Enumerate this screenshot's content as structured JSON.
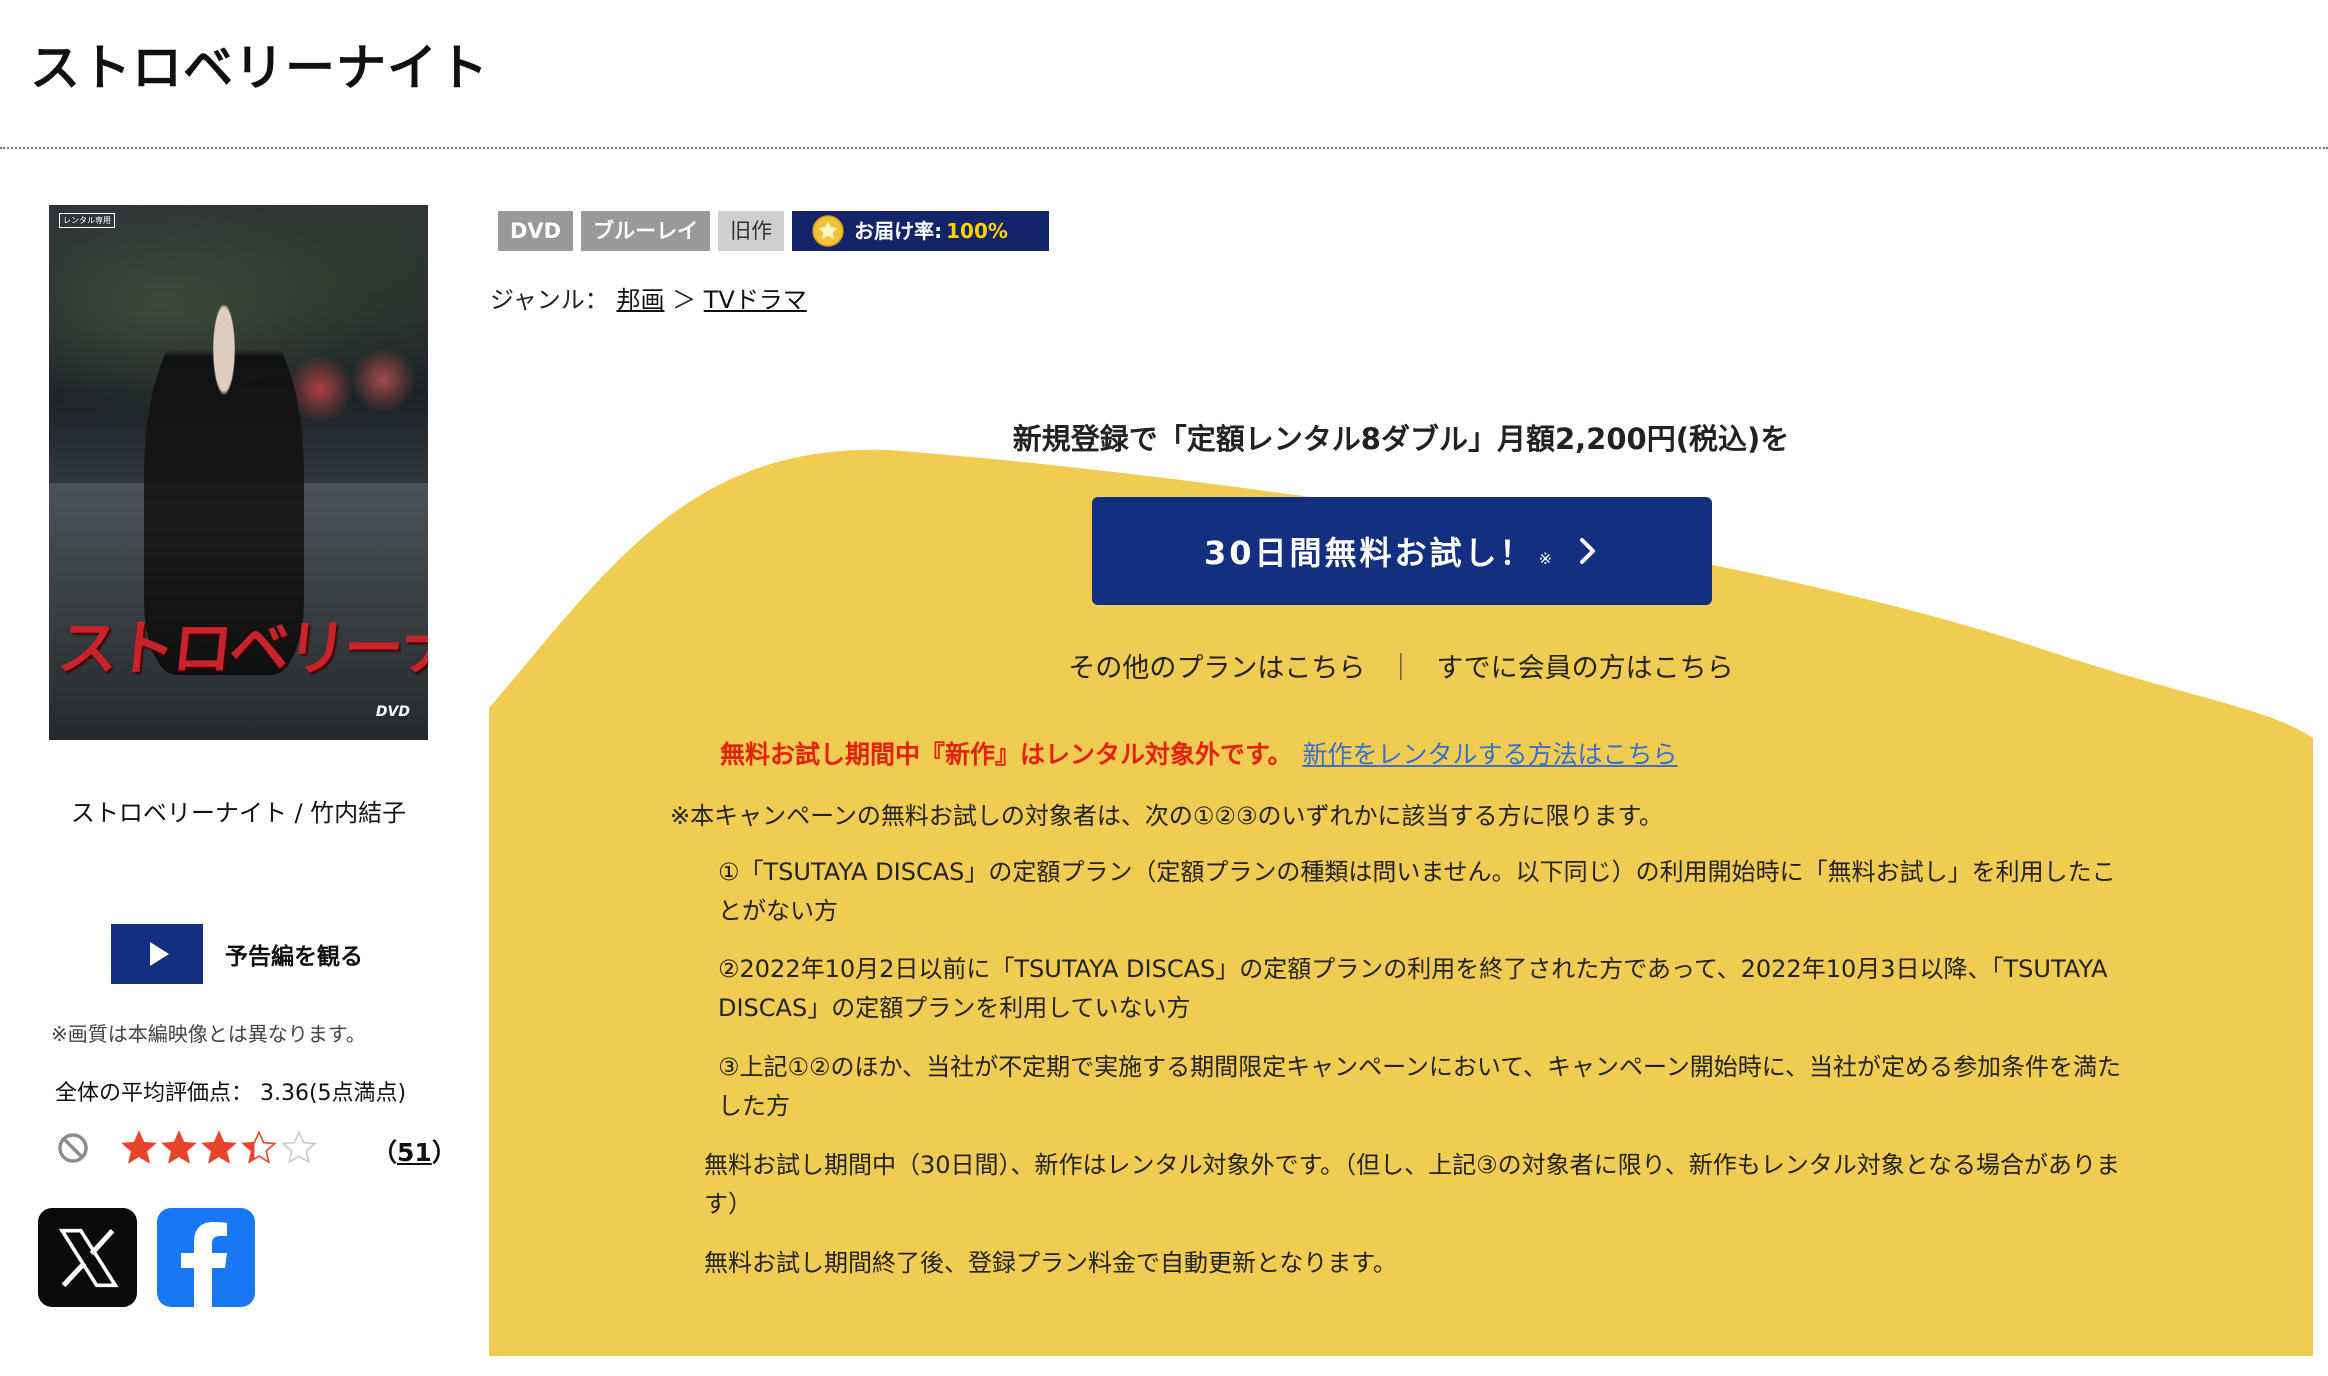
{
  "page": {
    "title": "ストロベリーナイト"
  },
  "poster": {
    "rental_tag": "レンタル専用",
    "title_text": "ストロベリーナイト",
    "format_mark": "DVD"
  },
  "caption": "ストロベリーナイト / 竹内結子",
  "trailer": {
    "label": "予告編を観る"
  },
  "quality_note": "※画質は本編映像とは異なります。",
  "rating": {
    "average_line": "全体の平均評価点： 3.36(5点満点)",
    "average": 3.36,
    "max": 5,
    "review_count_open": "（",
    "review_count": "51",
    "review_count_close": "）"
  },
  "badges": {
    "dvd": "DVD",
    "bluray": "ブルーレイ",
    "old": "旧作",
    "delivery_label": "お届け率:",
    "delivery_value": "100%"
  },
  "genre": {
    "prefix": "ジャンル：",
    "first": "邦画",
    "separator": "＞",
    "second": "TVドラマ"
  },
  "promo": {
    "headline": "新規登録で「定額レンタル8ダブル」月額2,200円(税込)を",
    "button_label": "30日間無料お試し！",
    "button_mark": "※",
    "other_plans": "その他のプランはこちら",
    "link_separator": "｜",
    "members": "すでに会員の方はこちら",
    "notice_red": "無料お試し期間中『新作』はレンタル対象外です。",
    "notice_link": "新作をレンタルする方法はこちら",
    "terms_intro": "※本キャンペーンの無料お試しの対象者は、次の①②③のいずれかに該当する方に限ります。",
    "conditions": [
      "①「TSUTAYA DISCAS」の定額プラン（定額プランの種類は問いません。以下同じ）の利用開始時に「無料お試し」を利用したことがない方",
      "②2022年10月2日以前に「TSUTAYA DISCAS」の定額プランの利用を終了された方であって、2022年10月3日以降、「TSUTAYA DISCAS」の定額プランを利用していない方",
      "③上記①②のほか、当社が不定期で実施する期間限定キャンペーンにおいて、キャンペーン開始時に、当社が定める参加条件を満たした方"
    ],
    "note_newrelease": "無料お試し期間中（30日間）、新作はレンタル対象外です。（但し、上記③の対象者に限り、新作もレンタル対象となる場合があります）",
    "note_renewal": "無料お試し期間終了後、登録プラン料金で自動更新となります。"
  },
  "colors": {
    "accent_navy": "#12307f",
    "badge_navy": "#13246b",
    "promo_yellow": "#f0cd52",
    "notice_red": "#e3220e",
    "link_blue": "#3a6fd0",
    "star_red": "#e8442c",
    "facebook_blue": "#1877f2"
  },
  "icons": {
    "play": "play-icon",
    "ban": "ban-icon",
    "star": "star-icon",
    "medal": "medal-icon",
    "chevron": "chevron-right-icon",
    "x": "x-logo-icon",
    "facebook": "facebook-logo-icon"
  }
}
